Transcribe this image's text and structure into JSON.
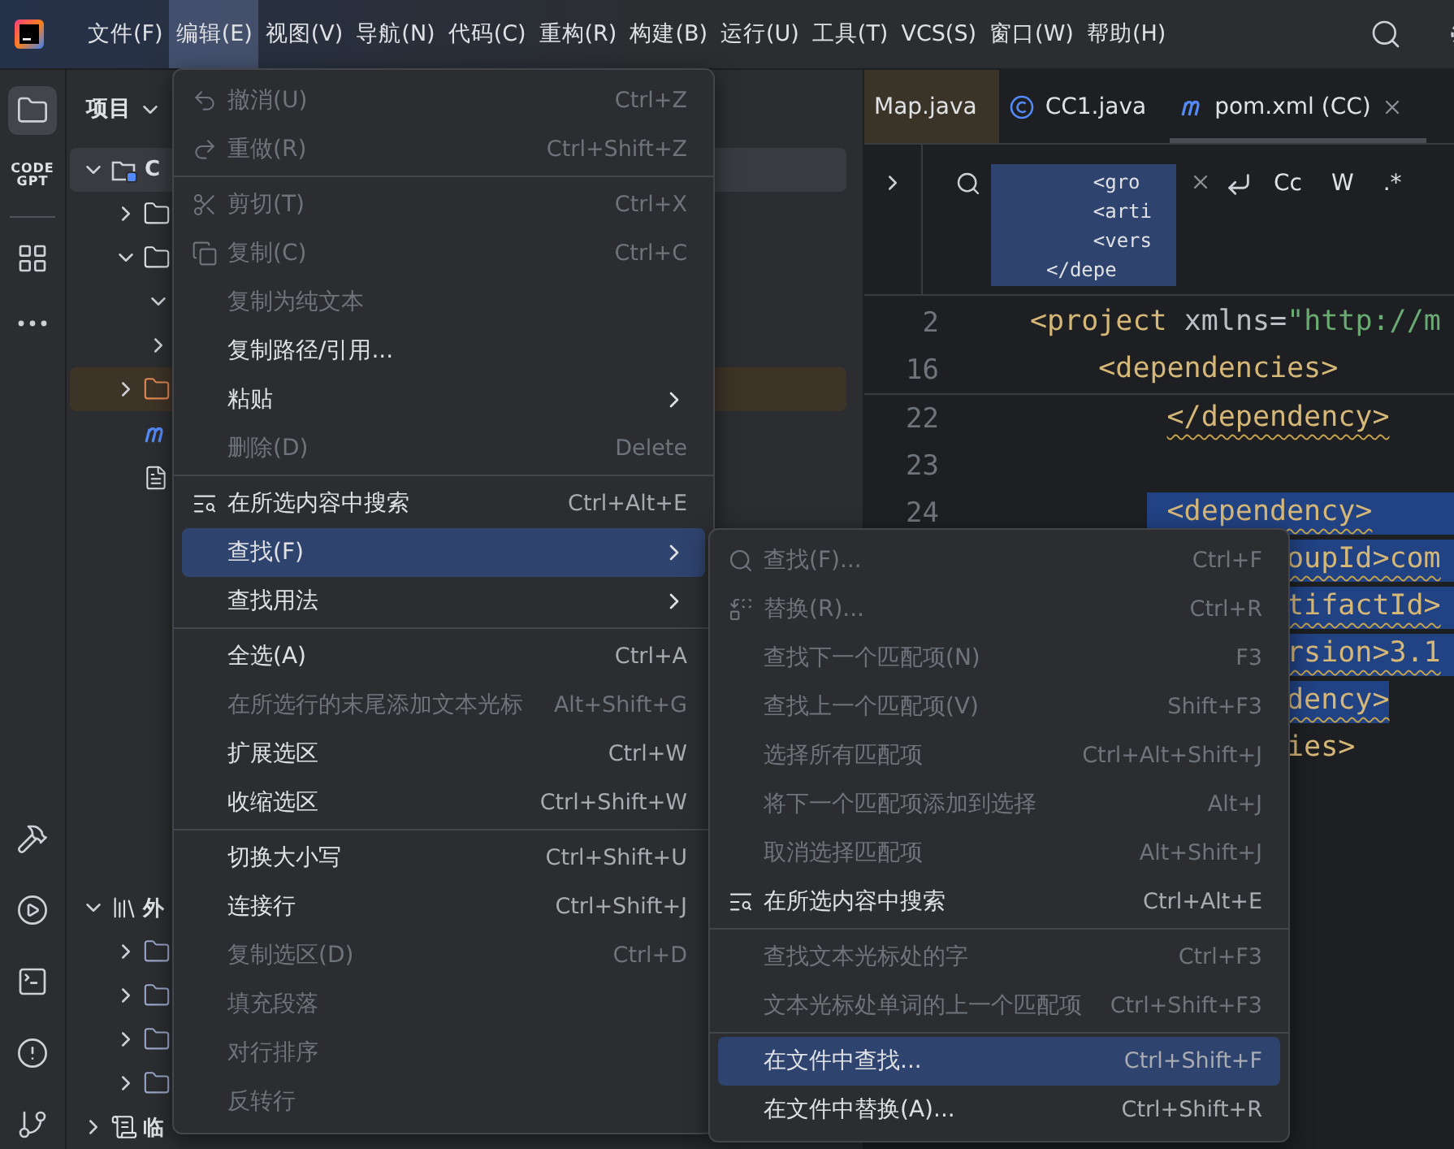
{
  "menubar": {
    "items": [
      {
        "label": "文件(F)",
        "selected": false
      },
      {
        "label": "编辑(E)",
        "selected": true
      },
      {
        "label": "视图(V)",
        "selected": false
      },
      {
        "label": "导航(N)",
        "selected": false
      },
      {
        "label": "代码(C)",
        "selected": false
      },
      {
        "label": "重构(R)",
        "selected": false
      },
      {
        "label": "构建(B)",
        "selected": false
      },
      {
        "label": "运行(U)",
        "selected": false
      },
      {
        "label": "工具(T)",
        "selected": false
      },
      {
        "label": "VCS(S)",
        "selected": false
      },
      {
        "label": "窗口(W)",
        "selected": false
      },
      {
        "label": "帮助(H)",
        "selected": false
      }
    ]
  },
  "left_toolbar": {
    "top": [
      {
        "kind": "project",
        "selected": true
      },
      {
        "kind": "codegpt",
        "label": "CODE GPT",
        "selected": false
      },
      {
        "kind": "structure",
        "selected": false
      },
      {
        "kind": "more",
        "selected": false
      }
    ],
    "bottom": [
      {
        "kind": "build",
        "selected": false
      },
      {
        "kind": "run",
        "selected": false
      },
      {
        "kind": "terminal",
        "selected": false
      },
      {
        "kind": "problems",
        "selected": false
      },
      {
        "kind": "git",
        "selected": false
      }
    ]
  },
  "project_panel": {
    "title": "项目",
    "tree": [
      {
        "kind": "module",
        "label": "C",
        "expanded": true,
        "selected": true,
        "children": [
          {
            "kind": "folder",
            "expanded": false,
            "selected": false
          },
          {
            "kind": "folder",
            "expanded": true,
            "selected": false,
            "children": [
              {
                "expanded": true,
                "selected": false
              },
              {
                "expanded": false,
                "selected": false
              }
            ]
          },
          {
            "kind": "excluded",
            "expanded": false,
            "selected": false
          },
          {
            "kind": "maven",
            "selected": false
          },
          {
            "kind": "file",
            "selected": false
          }
        ]
      },
      {
        "kind": "libraries",
        "label": "外",
        "expanded": true,
        "selected": false,
        "children": [
          {
            "kind": "library",
            "expanded": false,
            "selected": false
          },
          {
            "kind": "library",
            "expanded": false,
            "selected": false
          },
          {
            "kind": "library",
            "expanded": false,
            "selected": false
          },
          {
            "kind": "library",
            "expanded": false,
            "selected": false
          }
        ]
      },
      {
        "kind": "scratches",
        "label": "临",
        "expanded": false,
        "selected": false
      }
    ]
  },
  "editor": {
    "tabs": [
      {
        "label": "Map.java",
        "kind": "plain",
        "color": "#3a3428",
        "selected": false
      },
      {
        "label": "CC1.java",
        "kind": "class",
        "selected": false
      },
      {
        "label": "pom.xml (CC)",
        "kind": "maven",
        "selected": true
      }
    ],
    "find_bar": {
      "value_lines": [
        "  <gro",
        "  <arti",
        "  <vers",
        "</depe"
      ],
      "options": [
        "Cc",
        "W",
        ".*"
      ]
    },
    "sticky_lines": [
      {
        "number": "2",
        "selected": false,
        "warning": false,
        "tokens": [
          {
            "text": "<project",
            "kind": "tag"
          },
          {
            "text": " xmlns=",
            "kind": "attr"
          },
          {
            "text": "\"http://m",
            "kind": "string"
          }
        ]
      },
      {
        "number": "16",
        "selected": false,
        "warning": false,
        "tokens": [
          {
            "text": "    <dependencies>",
            "kind": "tag"
          }
        ]
      }
    ],
    "lines": [
      {
        "number": "22",
        "selected": false,
        "warning": true,
        "tokens": [
          {
            "text": "        </dependency>",
            "kind": "tag"
          }
        ]
      },
      {
        "number": "23",
        "selected": false
      },
      {
        "number": "24",
        "selected": true,
        "warning": true,
        "tokens": [
          {
            "text": "        <dependency>",
            "kind": "tag"
          }
        ]
      },
      {
        "selected": true,
        "warning": true,
        "tokens": [
          {
            "text": "               oupId>com",
            "kind": "tag"
          }
        ]
      },
      {
        "selected": true,
        "warning": true,
        "tokens": [
          {
            "text": "               tifactId>",
            "kind": "tag"
          }
        ]
      },
      {
        "selected": true,
        "warning": true,
        "tokens": [
          {
            "text": "               rsion>3.1",
            "kind": "tag"
          }
        ]
      },
      {
        "selected": true,
        "warning": true,
        "tokens": [
          {
            "text": "               dency>",
            "kind": "tag"
          }
        ]
      },
      {
        "selected": false,
        "warning": false,
        "tokens": [
          {
            "text": "               ies>",
            "kind": "tag"
          }
        ]
      }
    ]
  },
  "edit_menu": {
    "groups": [
      [
        {
          "label": "撤消(U)",
          "shortcut": "Ctrl+Z",
          "kind": "undo",
          "disabled": true,
          "selected": false
        },
        {
          "label": "重做(R)",
          "shortcut": "Ctrl+Shift+Z",
          "kind": "redo",
          "disabled": true,
          "selected": false
        }
      ],
      [
        {
          "label": "剪切(T)",
          "shortcut": "Ctrl+X",
          "kind": "cut",
          "disabled": true,
          "selected": false
        },
        {
          "label": "复制(C)",
          "shortcut": "Ctrl+C",
          "kind": "copy",
          "disabled": true,
          "selected": false
        },
        {
          "label": "复制为纯文本",
          "kind": "plain",
          "disabled": true,
          "selected": false
        },
        {
          "label": "复制路径/引用...",
          "kind": "plain",
          "disabled": false,
          "selected": false
        },
        {
          "label": "粘贴",
          "kind": "plain",
          "submenu": true,
          "disabled": false,
          "selected": false
        },
        {
          "label": "删除(D)",
          "shortcut": "Delete",
          "kind": "plain",
          "disabled": true,
          "selected": false
        }
      ],
      [
        {
          "label": "在所选内容中搜索",
          "shortcut": "Ctrl+Alt+E",
          "kind": "search-selection",
          "disabled": false,
          "selected": false
        },
        {
          "label": "查找(F)",
          "kind": "plain",
          "submenu": true,
          "disabled": false,
          "selected": true
        },
        {
          "label": "查找用法",
          "kind": "plain",
          "submenu": true,
          "disabled": false,
          "selected": false
        }
      ],
      [
        {
          "label": "全选(A)",
          "shortcut": "Ctrl+A",
          "kind": "plain",
          "disabled": false,
          "selected": false
        },
        {
          "label": "在所选行的末尾添加文本光标",
          "shortcut": "Alt+Shift+G",
          "kind": "plain",
          "disabled": true,
          "selected": false
        },
        {
          "label": "扩展选区",
          "shortcut": "Ctrl+W",
          "kind": "plain",
          "disabled": false,
          "selected": false
        },
        {
          "label": "收缩选区",
          "shortcut": "Ctrl+Shift+W",
          "kind": "plain",
          "disabled": false,
          "selected": false
        }
      ],
      [
        {
          "label": "切换大小写",
          "shortcut": "Ctrl+Shift+U",
          "kind": "plain",
          "disabled": false,
          "selected": false
        },
        {
          "label": "连接行",
          "shortcut": "Ctrl+Shift+J",
          "kind": "plain",
          "disabled": false,
          "selected": false
        },
        {
          "label": "复制选区(D)",
          "shortcut": "Ctrl+D",
          "kind": "plain",
          "disabled": true,
          "selected": false
        },
        {
          "label": "填充段落",
          "kind": "plain",
          "disabled": true,
          "selected": false
        },
        {
          "label": "对行排序",
          "kind": "plain",
          "disabled": true,
          "selected": false
        },
        {
          "label": "反转行",
          "kind": "plain",
          "disabled": true,
          "selected": false
        }
      ]
    ]
  },
  "find_submenu": {
    "groups": [
      [
        {
          "label": "查找(F)...",
          "shortcut": "Ctrl+F",
          "kind": "find",
          "disabled": true,
          "selected": false
        },
        {
          "label": "替换(R)...",
          "shortcut": "Ctrl+R",
          "kind": "replace",
          "disabled": true,
          "selected": false
        },
        {
          "label": "查找下一个匹配项(N)",
          "shortcut": "F3",
          "kind": "plain",
          "disabled": true,
          "selected": false
        },
        {
          "label": "查找上一个匹配项(V)",
          "shortcut": "Shift+F3",
          "kind": "plain",
          "disabled": true,
          "selected": false
        },
        {
          "label": "选择所有匹配项",
          "shortcut": "Ctrl+Alt+Shift+J",
          "kind": "plain",
          "disabled": true,
          "selected": false
        },
        {
          "label": "将下一个匹配项添加到选择",
          "shortcut": "Alt+J",
          "kind": "plain",
          "disabled": true,
          "selected": false
        },
        {
          "label": "取消选择匹配项",
          "shortcut": "Alt+Shift+J",
          "kind": "plain",
          "disabled": true,
          "selected": false
        },
        {
          "label": "在所选内容中搜索",
          "shortcut": "Ctrl+Alt+E",
          "kind": "search-selection",
          "disabled": false,
          "selected": false
        }
      ],
      [
        {
          "label": "查找文本光标处的字",
          "shortcut": "Ctrl+F3",
          "kind": "plain",
          "disabled": true,
          "selected": false
        },
        {
          "label": "文本光标处单词的上一个匹配项",
          "shortcut": "Ctrl+Shift+F3",
          "kind": "plain",
          "disabled": true,
          "selected": false
        }
      ],
      [
        {
          "label": "在文件中查找...",
          "shortcut": "Ctrl+Shift+F",
          "kind": "plain",
          "disabled": false,
          "selected": true
        },
        {
          "label": "在文件中替换(A)...",
          "shortcut": "Ctrl+Shift+R",
          "kind": "plain",
          "disabled": false,
          "selected": false
        }
      ]
    ]
  }
}
